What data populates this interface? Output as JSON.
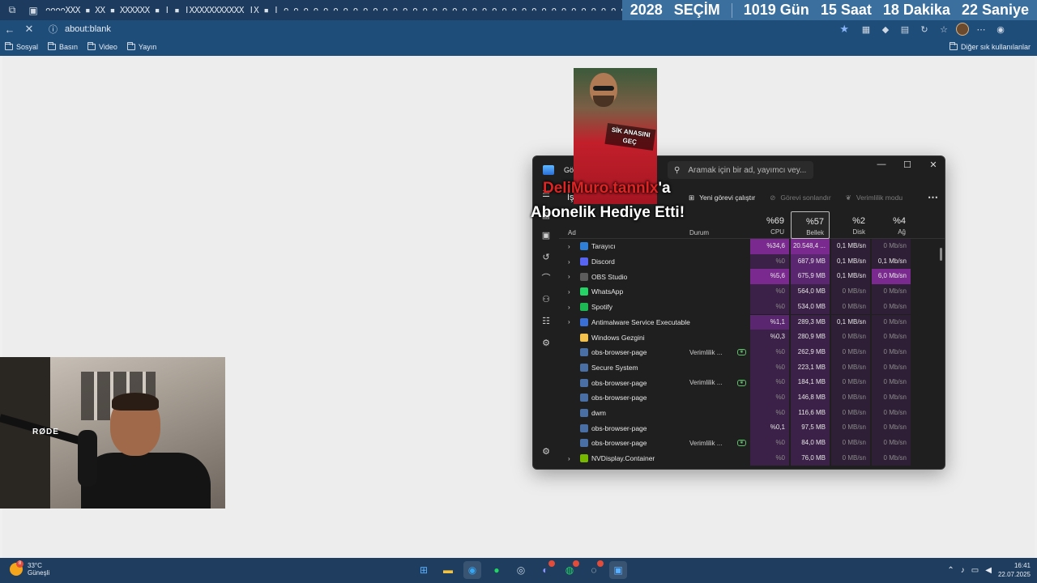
{
  "browser": {
    "tab_strip_text": "ᴖᴖᴖᴖXXX ▪ XX ▪ XXXXXX ▪ ǀ ▪ ǀXXXXXXXXXXX ǀX ▪ ǀ ᴖ ᴖ ᴖ ᴖ ᴖ ᴖ ᴖ ᴖ ᴖ ᴖ ᴖ ᴖ ᴖ ᴖ ᴖ ᴖ ᴖ ᴖ ᴖ ᴖ ᴖ ᴖ ᴖ ᴖ ᴖ ᴖ ᴖ ᴖ ᴖ ᴖ ᴖ ᴖ ᴖ ᴖ ᴖ ᴖ",
    "url": "about:blank",
    "bookmarks": [
      "Sosyal",
      "Basın",
      "Video",
      "Yayın"
    ],
    "other_bookmarks": "Diğer sık kullanılanlar"
  },
  "countdown": {
    "year": "2028",
    "election": "SEÇİM",
    "days": "1019 Gün",
    "hours": "15 Saat",
    "minutes": "18 Dakika",
    "seconds": "22 Saniye"
  },
  "task_manager": {
    "title": "Gör",
    "search_placeholder": "Aramak için bir ad, yayımcı vey...",
    "toolbar_title": "İş",
    "run_new_task": "Yeni görevi çalıştır",
    "end_task": "Görevi sonlandır",
    "efficiency_mode": "Verimlilik modu",
    "col_name": "Ad",
    "col_status": "Durum",
    "cpu_pct": "%69",
    "cpu_label": "CPU",
    "mem_pct": "%57",
    "mem_label": "Bellek",
    "disk_pct": "%2",
    "disk_label": "Disk",
    "net_pct": "%4",
    "net_label": "Ağ",
    "rows": [
      {
        "name": "Tarayıcı",
        "expand": "›",
        "status": "",
        "cpu": "%34,6",
        "mem": "20.548,4 ...",
        "disk": "0,1 MB/sn",
        "net": "0 Mb/sn"
      },
      {
        "name": "Discord",
        "expand": "›",
        "status": "",
        "cpu": "%0",
        "mem": "687,9 MB",
        "disk": "0,1 MB/sn",
        "net": "0,1 Mb/sn"
      },
      {
        "name": "OBS Studio",
        "expand": "›",
        "status": "",
        "cpu": "%5,6",
        "mem": "675,9 MB",
        "disk": "0,1 MB/sn",
        "net": "6,0 Mb/sn"
      },
      {
        "name": "WhatsApp",
        "expand": "›",
        "status": "",
        "cpu": "%0",
        "mem": "564,0 MB",
        "disk": "0 MB/sn",
        "net": "0 Mb/sn"
      },
      {
        "name": "Spotify",
        "expand": "›",
        "status": "",
        "cpu": "%0",
        "mem": "534,0 MB",
        "disk": "0 MB/sn",
        "net": "0 Mb/sn"
      },
      {
        "name": "Antimalware Service Executable",
        "expand": "›",
        "status": "",
        "cpu": "%1,1",
        "mem": "289,3 MB",
        "disk": "0,1 MB/sn",
        "net": "0 Mb/sn"
      },
      {
        "name": "Windows Gezgini",
        "expand": "",
        "status": "",
        "cpu": "%0,3",
        "mem": "280,9 MB",
        "disk": "0 MB/sn",
        "net": "0 Mb/sn"
      },
      {
        "name": "obs-browser-page",
        "expand": "",
        "status": "Verimlilik ...",
        "cpu": "%0",
        "mem": "262,9 MB",
        "disk": "0 MB/sn",
        "net": "0 Mb/sn"
      },
      {
        "name": "Secure System",
        "expand": "",
        "status": "",
        "cpu": "%0",
        "mem": "223,1 MB",
        "disk": "0 MB/sn",
        "net": "0 Mb/sn"
      },
      {
        "name": "obs-browser-page",
        "expand": "",
        "status": "Verimlilik ...",
        "cpu": "%0",
        "mem": "184,1 MB",
        "disk": "0 MB/sn",
        "net": "0 Mb/sn"
      },
      {
        "name": "obs-browser-page",
        "expand": "",
        "status": "",
        "cpu": "%0",
        "mem": "146,8 MB",
        "disk": "0 MB/sn",
        "net": "0 Mb/sn"
      },
      {
        "name": "dwm",
        "expand": "",
        "status": "",
        "cpu": "%0",
        "mem": "116,6 MB",
        "disk": "0 MB/sn",
        "net": "0 Mb/sn"
      },
      {
        "name": "obs-browser-page",
        "expand": "",
        "status": "",
        "cpu": "%0,1",
        "mem": "97,5 MB",
        "disk": "0 MB/sn",
        "net": "0 Mb/sn"
      },
      {
        "name": "obs-browser-page",
        "expand": "",
        "status": "Verimlilik ...",
        "cpu": "%0",
        "mem": "84,0 MB",
        "disk": "0 MB/sn",
        "net": "0 Mb/sn"
      },
      {
        "name": "NVDisplay.Container",
        "expand": "›",
        "status": "",
        "cpu": "%0",
        "mem": "76,0 MB",
        "disk": "0 MB/sn",
        "net": "0 Mb/sn"
      }
    ]
  },
  "overlay": {
    "photo_caption": "SİK ANASINI GEÇ",
    "alert_user": "DeliMuro.tannlx",
    "alert_suffix": "'a",
    "alert_line2": "Abonelik Hediye Etti!",
    "rode_label": "RØDE"
  },
  "taskbar": {
    "temperature": "33°C",
    "weather": "Güneşli",
    "weather_badge": "8",
    "time": "16:41",
    "date": "22.07.2025"
  },
  "colors": {
    "cpu_hi": "#7a2a8e",
    "cpu_mid": "#5a2670",
    "cpu_lo": "#3b2047",
    "accent": "#8ab4f8"
  }
}
